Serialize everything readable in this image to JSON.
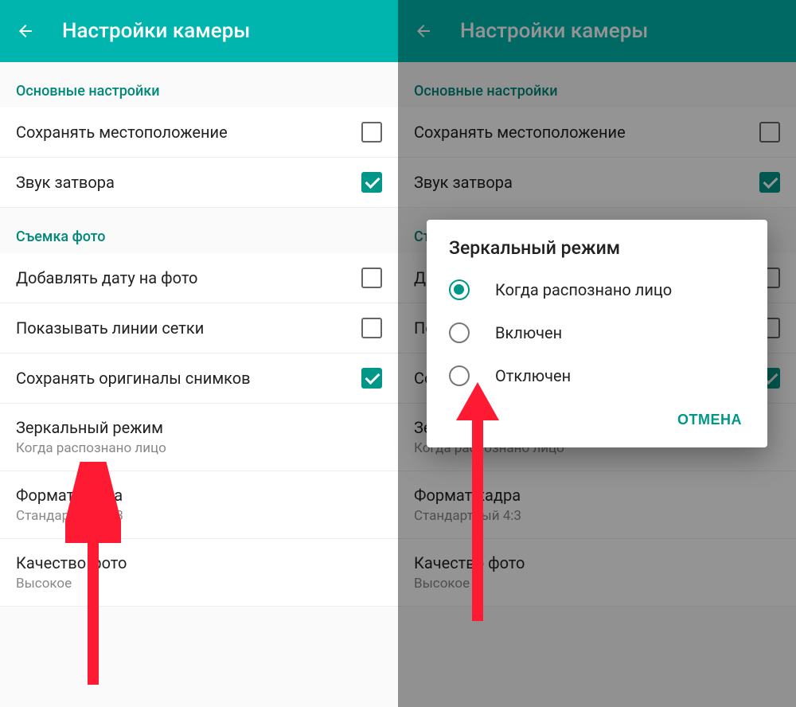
{
  "accent": "#009688",
  "header_bg": "#00B5AD",
  "left": {
    "title": "Настройки камеры",
    "section1": "Основные настройки",
    "row_location": {
      "label": "Сохранять местоположение",
      "checked": false
    },
    "row_shutter": {
      "label": "Звук затвора",
      "checked": true
    },
    "section2": "Съемка фото",
    "row_date": {
      "label": "Добавлять дату на фото",
      "checked": false
    },
    "row_grid": {
      "label": "Показывать линии сетки",
      "checked": false
    },
    "row_orig": {
      "label": "Сохранять оригиналы снимков",
      "checked": true
    },
    "row_mirror": {
      "label": "Зеркальный режим",
      "sub": "Когда распознано лицо"
    },
    "row_format": {
      "label": "Формат кадра",
      "sub": "Стандартный 4:3"
    },
    "row_quality": {
      "label": "Качество фото",
      "sub": "Высокое"
    }
  },
  "right": {
    "title": "Настройки камеры",
    "section1": "Основные настройки",
    "dialog": {
      "title": "Зеркальный режим",
      "options": [
        {
          "label": "Когда распознано лицо",
          "selected": true
        },
        {
          "label": "Включен",
          "selected": false
        },
        {
          "label": "Отключен",
          "selected": false
        }
      ],
      "cancel": "ОТМЕНА"
    }
  }
}
